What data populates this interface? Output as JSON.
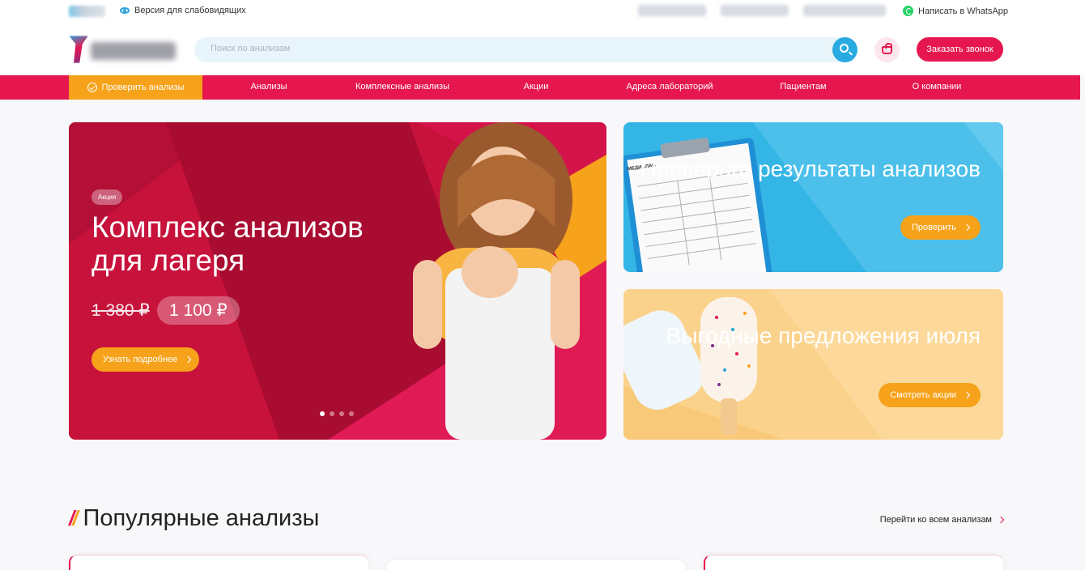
{
  "topbar": {
    "vision_label": "Версия для слабовидящих",
    "whatsapp_label": "Написать в WhatsApp"
  },
  "header": {
    "search_placeholder": "Поиск по анализам",
    "call_button": "Заказать звонок"
  },
  "nav": {
    "check_label": "Проверить анализы",
    "items": [
      "Анализы",
      "Комплексные анализы",
      "Акции",
      "Адреса лабораторий",
      "Пациентам",
      "О компании"
    ]
  },
  "hero": {
    "badge": "Акция",
    "title": "Комплекс анализов для лагеря",
    "old_price": "1 380 ₽",
    "new_price": "1 100 ₽",
    "button": "Узнать подробнее",
    "slides_total": 4,
    "active_slide": 1
  },
  "card_results": {
    "title": "Проверьте результаты анализов",
    "button": "Проверить",
    "doc_brand": "МЕДИАЛАБ"
  },
  "card_offers": {
    "title": "Выгодные предложения июля",
    "button": "Смотреть акции"
  },
  "popular": {
    "title": "Популярные анализы",
    "all_link": "Перейти ко всем анализам"
  },
  "colors": {
    "brand_red": "#e6174f",
    "accent_orange": "#f6a21a",
    "accent_blue": "#29abe2"
  }
}
